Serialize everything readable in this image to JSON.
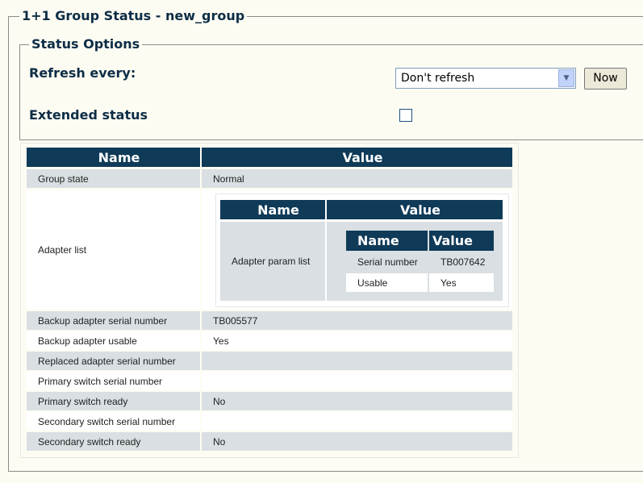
{
  "title": "1+1 Group Status - new_group",
  "status_options": {
    "legend": "Status Options",
    "refresh_label": "Refresh every:",
    "refresh_value": "Don't refresh",
    "now_button": "Now",
    "extended_label": "Extended status",
    "extended_checked": false
  },
  "table": {
    "headers": [
      "Name",
      "Value"
    ],
    "rows": [
      {
        "name": "Group state",
        "value": "Normal"
      },
      {
        "name": "Adapter list",
        "value": ""
      },
      {
        "name": "Backup adapter serial number",
        "value": "TB005577"
      },
      {
        "name": "Backup adapter usable",
        "value": "Yes"
      },
      {
        "name": "Replaced adapter serial number",
        "value": ""
      },
      {
        "name": "Primary switch serial number",
        "value": ""
      },
      {
        "name": "Primary switch ready",
        "value": "No"
      },
      {
        "name": "Secondary switch serial number",
        "value": ""
      },
      {
        "name": "Secondary switch ready",
        "value": "No"
      }
    ]
  },
  "adapter_table": {
    "headers": [
      "Name",
      "Value"
    ],
    "row_name": "Adapter param list",
    "params": {
      "headers": [
        "Name",
        "Value"
      ],
      "rows": [
        {
          "name": "Serial number",
          "value": "TB007642"
        },
        {
          "name": "Usable",
          "value": "Yes"
        }
      ]
    }
  }
}
